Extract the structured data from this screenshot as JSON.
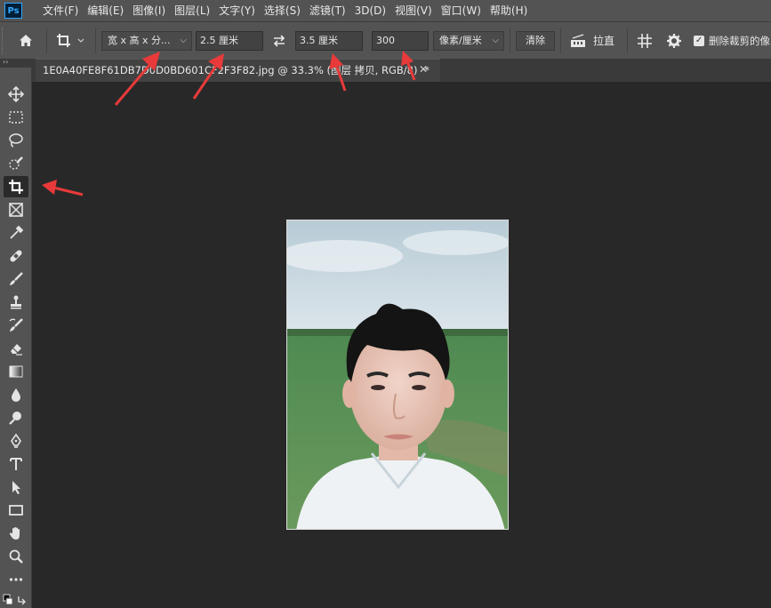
{
  "app": {
    "logo": "Ps"
  },
  "menu": [
    "文件(F)",
    "编辑(E)",
    "图像(I)",
    "图层(L)",
    "文字(Y)",
    "选择(S)",
    "滤镜(T)",
    "3D(D)",
    "视图(V)",
    "窗口(W)",
    "帮助(H)"
  ],
  "options": {
    "ratio_preset": "宽 x 高 x 分...",
    "width_value": "2.5 厘米",
    "height_value": "3.5 厘米",
    "resolution_value": "300",
    "resolution_unit": "像素/厘米",
    "clear_label": "清除",
    "straighten_label": "拉直",
    "delete_cropped_label": "删除裁剪的像"
  },
  "document_tab": {
    "title": "1E0A40FE8F61DB7D0D0BD601CF2F3F82.jpg @ 33.3% (图层 拷贝, RGB/8)",
    "modified_marker": "*"
  },
  "toolbar": {
    "collapse_glyph": "››",
    "active_tool": "crop-tool",
    "tools": [
      "move-tool",
      "marquee-tool",
      "lasso-tool",
      "quick-selection-tool",
      "crop-tool",
      "frame-tool",
      "eyedropper-tool",
      "healing-brush-tool",
      "brush-tool",
      "clone-stamp-tool",
      "history-brush-tool",
      "eraser-tool",
      "gradient-tool",
      "blur-tool",
      "dodge-tool",
      "pen-tool",
      "type-tool",
      "path-selection-tool",
      "rectangle-tool",
      "hand-tool",
      "zoom-tool",
      "more-tools"
    ]
  },
  "colors": {
    "ui_panel": "#535353",
    "canvas_background": "#282828",
    "annotation_arrow": "#e83a3a",
    "ps_logo_blue": "#31a8ff"
  }
}
